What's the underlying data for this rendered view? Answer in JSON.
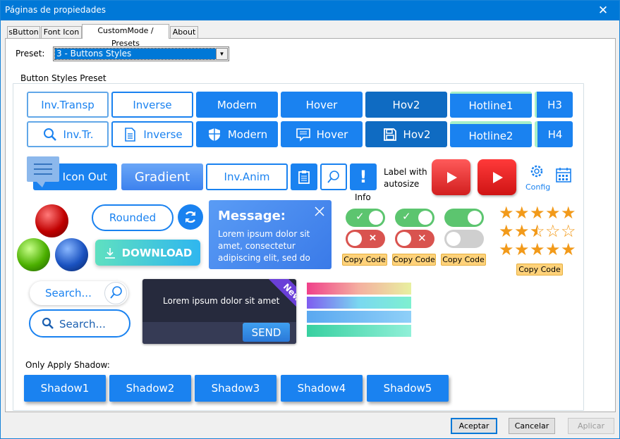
{
  "window": {
    "title": "Páginas de propiedades",
    "close": "✕"
  },
  "tabs": [
    "sButton",
    "Font Icon",
    "CustomMode / Presets",
    "About"
  ],
  "preset": {
    "label": "Preset:",
    "value": "3 - Buttons Styles"
  },
  "group": {
    "label": "Button Styles Preset"
  },
  "row1": [
    "Inv.Transp",
    "Inverse",
    "Modern",
    "Hover",
    "Hov2",
    "Hotline1",
    "H3"
  ],
  "row2": [
    "Inv.Tr.",
    "Inverse",
    "Modern",
    "Hover",
    "Hov2",
    "Hotline2",
    "H4"
  ],
  "row3": {
    "icon_out": "Icon Out",
    "gradient": "Gradient",
    "inv_anim": "Inv.Anim",
    "info": "Info",
    "autosize": "Label with autosize",
    "config": "Config"
  },
  "row4": {
    "rounded": "Rounded",
    "download": "DOWNLOAD",
    "msg_title": "Message:",
    "msg_body": "Lorem ipsum dolor sit amet, consectetur adipiscing elit, sed do ei...",
    "copy": "Copy Code"
  },
  "stars": [
    5,
    2.5,
    5
  ],
  "row5": {
    "search1": "Search...",
    "search2": "Search...",
    "card_text": "Lorem ipsum dolor sit amet",
    "ribbon": "New",
    "send": "SEND"
  },
  "shadow": {
    "label": "Only Apply Shadow:",
    "buttons": [
      "Shadow1",
      "Shadow2",
      "Shadow3",
      "Shadow4",
      "Shadow5"
    ]
  },
  "footer": {
    "ok": "Aceptar",
    "cancel": "Cancelar",
    "apply": "Aplicar"
  },
  "colors": {
    "accent": "#1a82f0",
    "titlebar": "#0078d7",
    "toggle_on": "#5cc56f",
    "toggle_off_red": "#d9534f",
    "toggle_gray": "#bfbfbf",
    "copy_bg": "#ffd27a",
    "star": "#f29a1a"
  }
}
